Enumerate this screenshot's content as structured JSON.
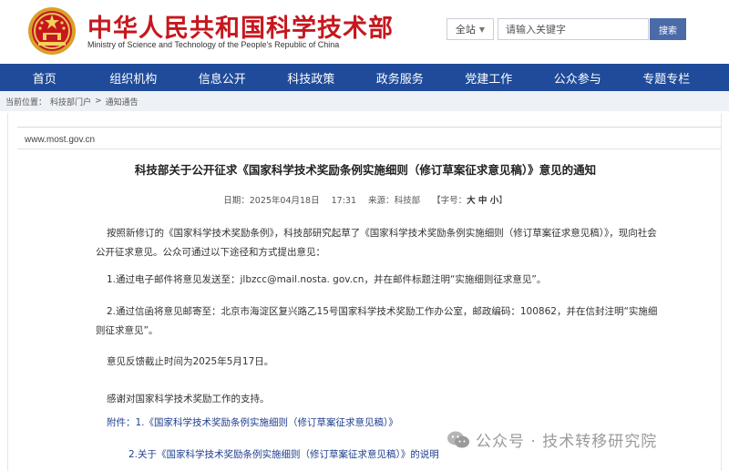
{
  "header": {
    "title": "中华人民共和国科学技术部",
    "subtitle": "Ministry of Science and Technology of the People's Republic of China",
    "emblem_icon": "national-emblem-icon",
    "brand_color": "#c6171e"
  },
  "search": {
    "scope": "全站",
    "placeholder": "请输入关键字",
    "button": "搜索"
  },
  "nav": {
    "items": [
      "首页",
      "组织机构",
      "信息公开",
      "科技政策",
      "政务服务",
      "党建工作",
      "公众参与",
      "专题专栏"
    ],
    "color": "#1f4b9a"
  },
  "breadcrumb": {
    "label": "当前位置：",
    "path1": "科技部门户",
    "sep": ">",
    "path2": "通知通告"
  },
  "article": {
    "domain": "www.most.gov.cn",
    "title": "科技部关于公开征求《国家科学技术奖励条例实施细则（修订草案征求意见稿）》意见的通知",
    "date_label": "日期：",
    "date": "2025年04月18日",
    "time": "17:31",
    "source_label": "来源：",
    "source": "科技部",
    "font_label": "【字号：",
    "font_sizes": "大 中 小",
    "font_close": "】",
    "p1": "按照新修订的《国家科学技术奖励条例》，科技部研究起草了《国家科学技术奖励条例实施细则（修订草案征求意见稿）》，现向社会公开征求意见。公众可通过以下途径和方式提出意见：",
    "p2": "1.通过电子邮件将意见发送至：jlbzcc@mail.nosta. gov.cn，并在邮件标题注明“实施细则征求意见”。",
    "p3": "2.通过信函将意见邮寄至：北京市海淀区复兴路乙15号国家科学技术奖励工作办公室，邮政编码：100862，并在信封注明“实施细则征求意见”。",
    "p4": "意见反馈截止时间为2025年5月17日。",
    "p5": "感谢对国家科学技术奖励工作的支持。",
    "attach_label": "附件：",
    "attach1": "1.《国家科学技术奖励条例实施细则（修订草案征求意见稿）》",
    "attach2": "2.关于《国家科学技术奖励条例实施细则（修订草案征求意见稿）》的说明",
    "link_color": "#1f3f8f"
  },
  "watermark": {
    "text": "公众号 · 技术转移研究院",
    "icon": "wechat-icon"
  }
}
